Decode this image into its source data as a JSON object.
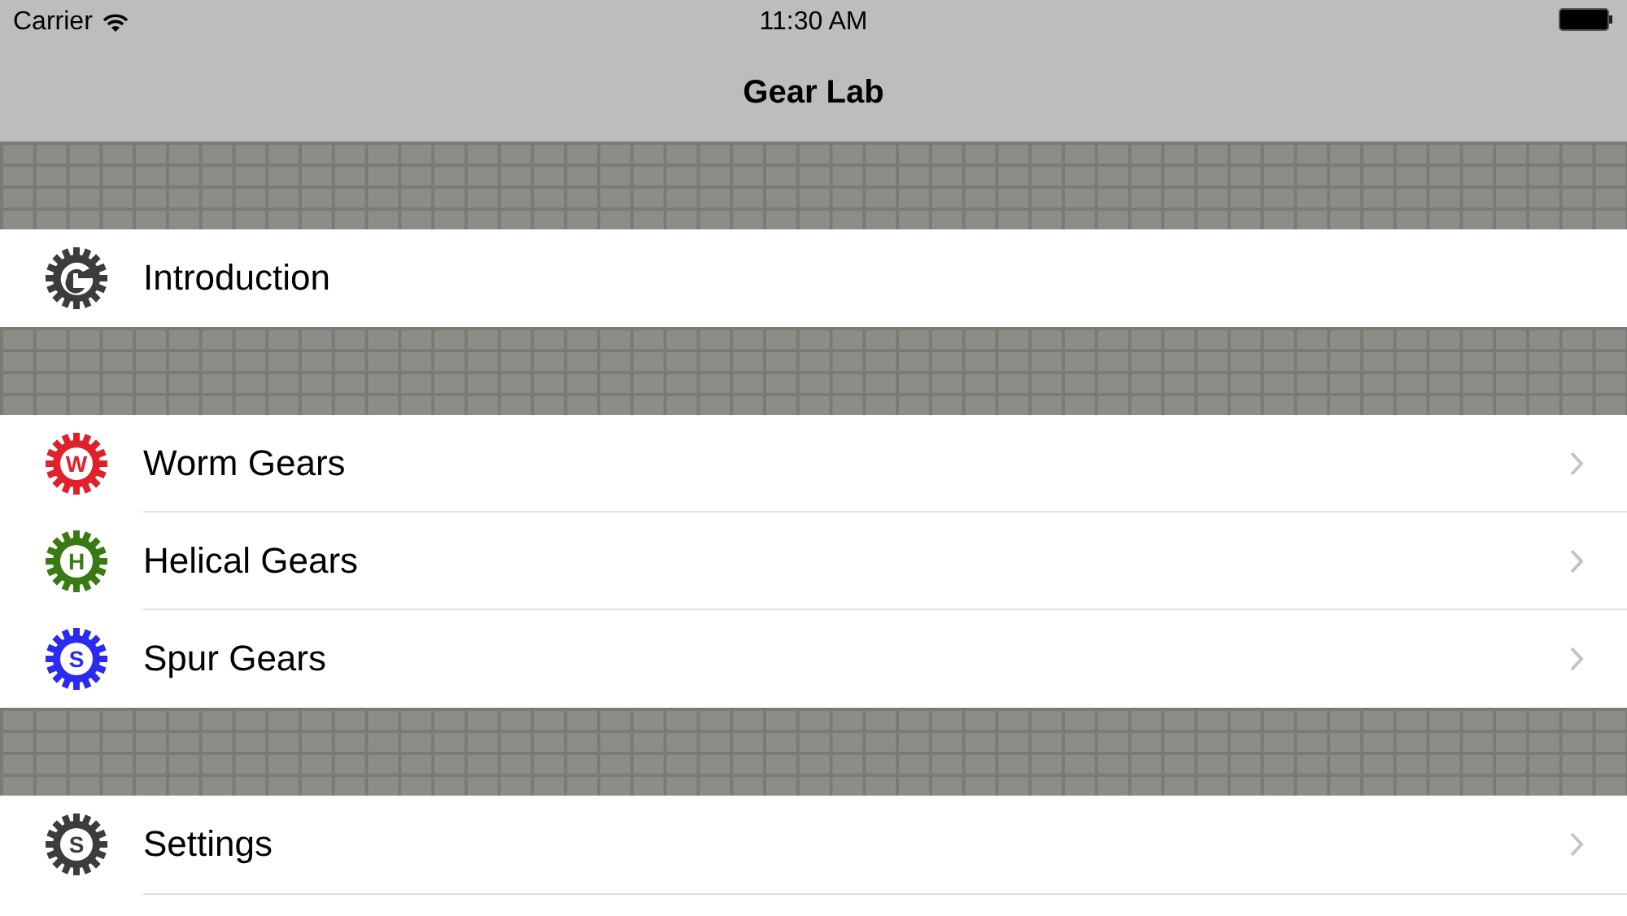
{
  "status_bar": {
    "carrier": "Carrier",
    "time": "11:30 AM"
  },
  "nav": {
    "title": "Gear Lab"
  },
  "sections": [
    {
      "items": [
        {
          "label": "Introduction",
          "kind": "intro",
          "color": "#3c3c3c",
          "chevron": false
        }
      ]
    },
    {
      "items": [
        {
          "label": "Worm Gears",
          "kind": "letter",
          "letter": "W",
          "color": "#e0202a",
          "chevron": true
        },
        {
          "label": "Helical Gears",
          "kind": "letter",
          "letter": "H",
          "color": "#3a7a14",
          "chevron": true
        },
        {
          "label": "Spur Gears",
          "kind": "letter",
          "letter": "S",
          "color": "#2a2af0",
          "chevron": true
        }
      ]
    },
    {
      "items": [
        {
          "label": "Settings",
          "kind": "letter",
          "letter": "S",
          "color": "#3c3c3c",
          "chevron": true
        }
      ]
    }
  ]
}
